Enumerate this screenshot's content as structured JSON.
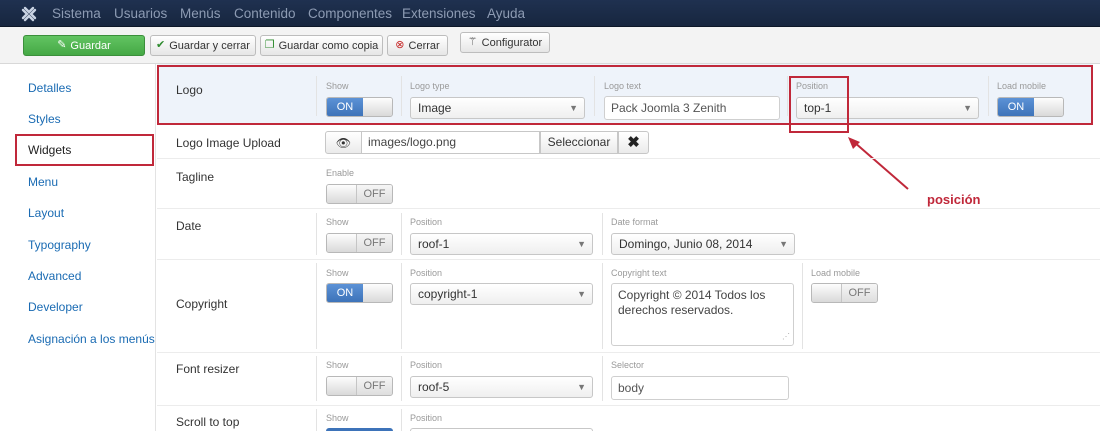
{
  "topnav": {
    "items": [
      "Sistema",
      "Usuarios",
      "Menús",
      "Contenido",
      "Componentes",
      "Extensiones",
      "Ayuda"
    ]
  },
  "toolbar": {
    "save": "Guardar",
    "save_close": "Guardar y cerrar",
    "save_copy": "Guardar como copia",
    "close": "Cerrar",
    "configurator": "Configurator"
  },
  "sidebar": {
    "items": [
      "Detalles",
      "Styles",
      "Widgets",
      "Menu",
      "Layout",
      "Typography",
      "Advanced",
      "Developer",
      "Asignación a los menús"
    ],
    "active": "Widgets"
  },
  "rows": {
    "logo": {
      "label": "Logo",
      "show_lbl": "Show",
      "show_on": "ON",
      "type_lbl": "Logo type",
      "type_val": "Image",
      "text_lbl": "Logo text",
      "text_val": "Pack Joomla 3 Zenith",
      "pos_lbl": "Position",
      "pos_val": "top-1",
      "mobile_lbl": "Load mobile",
      "mobile_on": "ON"
    },
    "logo_upload": {
      "label": "Logo Image Upload",
      "path": "images/logo.png",
      "select": "Seleccionar"
    },
    "tagline": {
      "label": "Tagline",
      "enable_lbl": "Enable",
      "off": "OFF"
    },
    "date": {
      "label": "Date",
      "show_lbl": "Show",
      "off": "OFF",
      "pos_lbl": "Position",
      "pos_val": "roof-1",
      "format_lbl": "Date format",
      "format_val": "Domingo, Junio 08, 2014"
    },
    "copyright": {
      "label": "Copyright",
      "show_lbl": "Show",
      "on": "ON",
      "pos_lbl": "Position",
      "pos_val": "copyright-1",
      "text_lbl": "Copyright text",
      "text_val": "Copyright © 2014 Todos los derechos reservados.",
      "mobile_lbl": "Load mobile",
      "off": "OFF"
    },
    "font_resizer": {
      "label": "Font resizer",
      "show_lbl": "Show",
      "off": "OFF",
      "pos_lbl": "Position",
      "pos_val": "roof-5",
      "selector_lbl": "Selector",
      "selector_val": "body"
    },
    "scroll_top": {
      "label": "Scroll to top",
      "show_lbl": "Show",
      "pos_lbl": "Position"
    }
  },
  "annotation": {
    "text": "posición",
    "color": "#c0283a"
  },
  "colors": {
    "nav_bg": "#1f3150",
    "save_green": "#45a845",
    "toggle_blue": "#3d73b9",
    "link": "#1a6bb3"
  }
}
